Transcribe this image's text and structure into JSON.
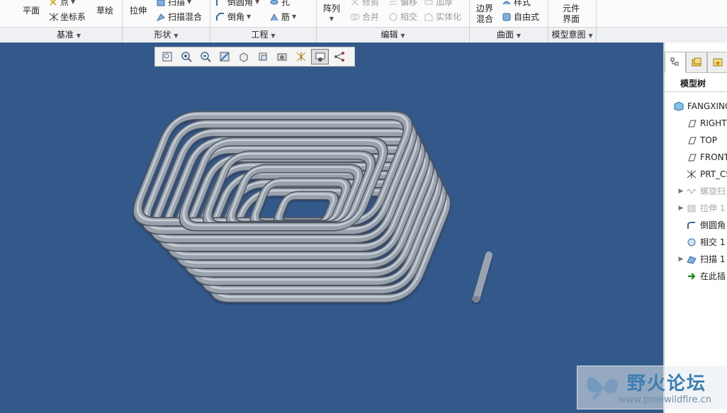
{
  "ribbon": {
    "plane": "平面",
    "point": "点",
    "csys": "坐标系",
    "sketch": "草绘",
    "extrude": "拉伸",
    "sweep": "扫描",
    "swept_blend": "扫描混合",
    "round": "倒圆角",
    "chamfer": "倒角",
    "hole": "孔",
    "rib": "筋",
    "pattern": "阵列",
    "trim": "修剪",
    "merge": "合并",
    "offset": "偏移",
    "intersect": "相交",
    "thicken": "加厚",
    "solidify": "实体化",
    "boundary_blend_1": "边界",
    "boundary_blend_2": "混合",
    "style": "样式",
    "freestyle": "自由式",
    "component_1": "元件",
    "component_2": "界面",
    "groups": [
      "基准",
      "形状",
      "工程",
      "编辑",
      "曲面",
      "模型意图"
    ]
  },
  "model_tree": {
    "title": "模型树",
    "root": "FANGXING",
    "items": [
      {
        "label": "RIGHT",
        "icon": "datum-plane-icon",
        "expand": false,
        "dim": false
      },
      {
        "label": "TOP",
        "icon": "datum-plane-icon",
        "expand": false,
        "dim": false
      },
      {
        "label": "FRONT",
        "icon": "datum-plane-icon",
        "expand": false,
        "dim": false
      },
      {
        "label": "PRT_CS",
        "icon": "csys-icon",
        "expand": false,
        "dim": false
      },
      {
        "label": "螺旋扫",
        "icon": "helical-sweep-icon",
        "expand": true,
        "dim": true
      },
      {
        "label": "拉伸 1",
        "icon": "extrude-icon",
        "expand": true,
        "dim": true
      },
      {
        "label": "倒圆角",
        "icon": "round-icon",
        "expand": false,
        "dim": false
      },
      {
        "label": "相交 1",
        "icon": "intersect-icon",
        "expand": false,
        "dim": false
      },
      {
        "label": "扫描 1",
        "icon": "sweep-icon",
        "expand": true,
        "dim": false
      },
      {
        "label": "在此插",
        "icon": "insert-arrow-icon",
        "expand": false,
        "dim": false
      }
    ]
  },
  "watermark": {
    "title": "野火论坛",
    "url": "www.proewildfire.cn"
  },
  "colors": {
    "viewport": "#33598b",
    "tube": "#9aa3ad"
  }
}
